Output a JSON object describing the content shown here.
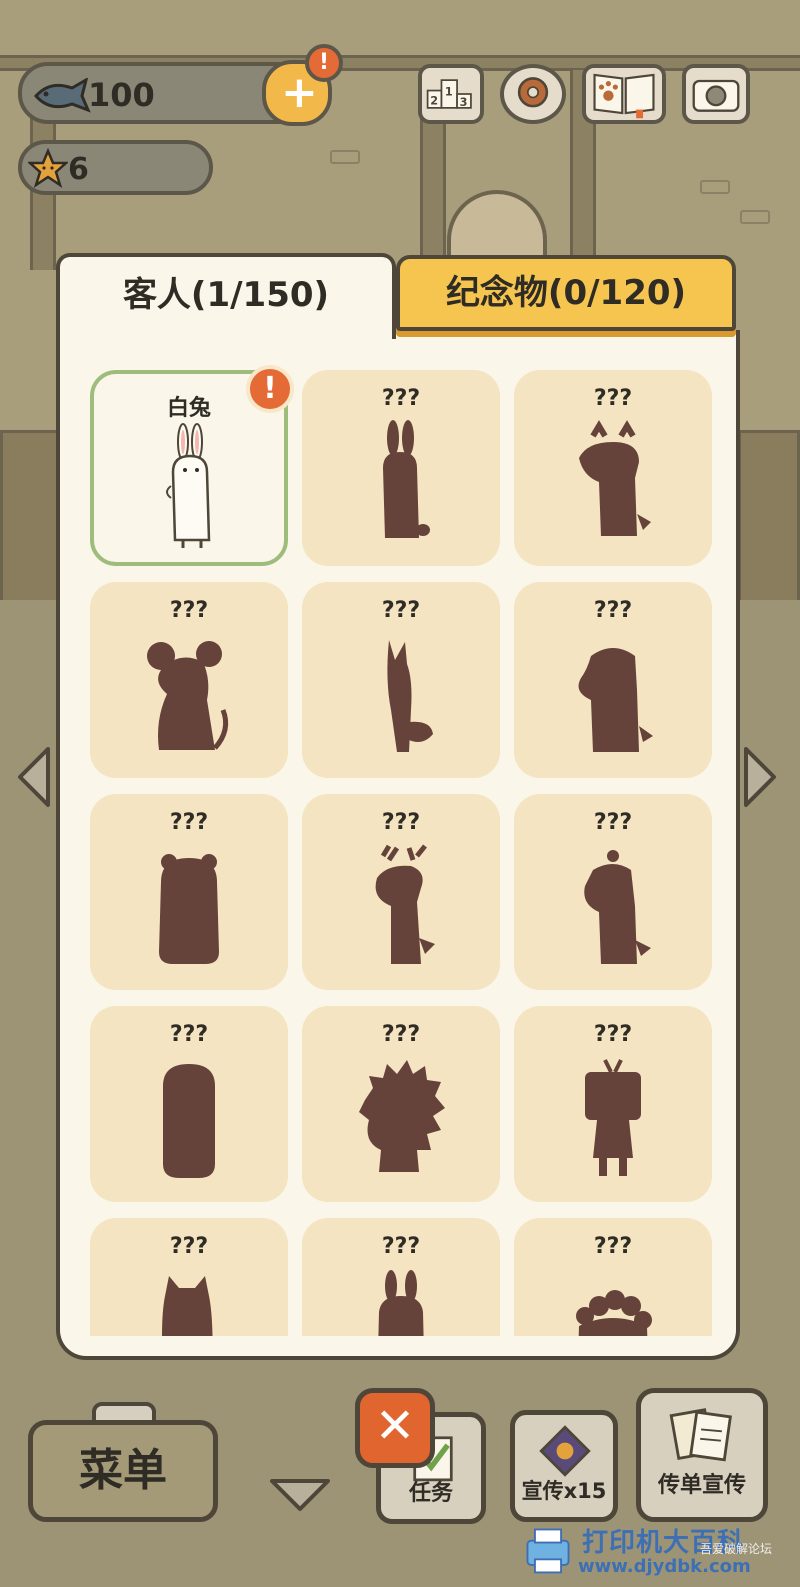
{
  "hud": {
    "fish_count": "100",
    "star_count": "6",
    "plus_alert": "!",
    "icons": [
      "ranking-podium-icon",
      "settings-gear-icon",
      "paw-book-icon",
      "camera-icon"
    ],
    "ranking_digits": "213"
  },
  "tabs": {
    "guests_label": "客人(1/150)",
    "souvenirs_label": "纪念物(0/120)"
  },
  "guests": [
    {
      "name": "白兔",
      "silhouette": "rabbit",
      "discovered": true,
      "alert": "!"
    },
    {
      "name": "???",
      "silhouette": "rabbit"
    },
    {
      "name": "???",
      "silhouette": "moose"
    },
    {
      "name": "???",
      "silhouette": "mouse"
    },
    {
      "name": "???",
      "silhouette": "fox"
    },
    {
      "name": "???",
      "silhouette": "otter"
    },
    {
      "name": "???",
      "silhouette": "bear"
    },
    {
      "name": "???",
      "silhouette": "deer"
    },
    {
      "name": "???",
      "silhouette": "capybara"
    },
    {
      "name": "???",
      "silhouette": "seal"
    },
    {
      "name": "???",
      "silhouette": "hedgehog"
    },
    {
      "name": "???",
      "silhouette": "tv-head"
    },
    {
      "name": "???",
      "silhouette": "cat"
    },
    {
      "name": "???",
      "silhouette": "donkey"
    },
    {
      "name": "???",
      "silhouette": "sheep"
    }
  ],
  "bottom": {
    "menu_label": "菜单",
    "close_label": "✕",
    "task_label": "任务",
    "promo_label": "宣传x15",
    "flyer_label": "传单宣传"
  },
  "watermark": {
    "text": "打印机大百科",
    "url": "www.djydbk.com",
    "small": "吾爱破解论坛"
  },
  "colors": {
    "panel_bg": "#fbf6ea",
    "cell_bg": "#f4e4c1",
    "silhouette": "#65423a",
    "tab_inactive": "#f6c54f",
    "selected_border": "#9ebd7c",
    "alert": "#e46a36"
  }
}
